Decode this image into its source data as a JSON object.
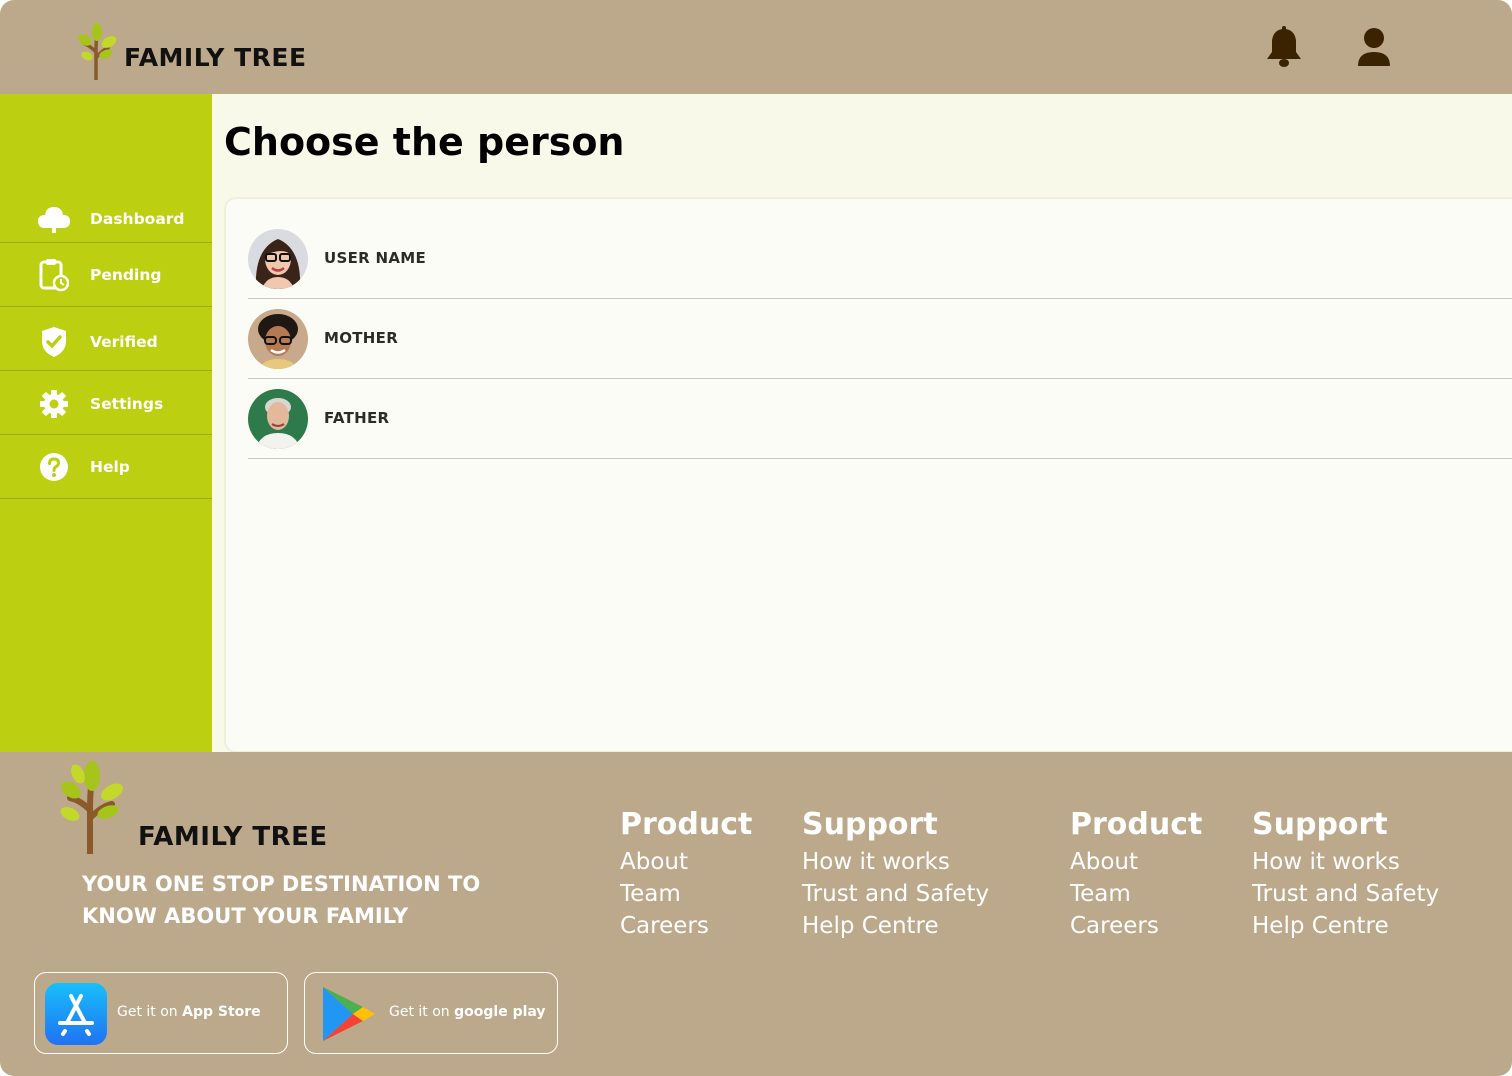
{
  "header": {
    "brand": "FAMILY TREE",
    "icons": [
      "tree-logo-icon",
      "bell-icon",
      "user-icon"
    ]
  },
  "sidebar": {
    "items": [
      {
        "label": "Dashboard",
        "icon": "cloud-icon"
      },
      {
        "label": "Pending",
        "icon": "clipboard-clock-icon"
      },
      {
        "label": "Verified",
        "icon": "shield-check-icon"
      },
      {
        "label": "Settings",
        "icon": "gear-icon"
      },
      {
        "label": "Help",
        "icon": "question-icon"
      }
    ]
  },
  "main": {
    "title": "Choose the person",
    "people": [
      {
        "name": "USER NAME"
      },
      {
        "name": "MOTHER"
      },
      {
        "name": "FATHER"
      }
    ]
  },
  "footer": {
    "brand": "FAMILY TREE",
    "tagline": "YOUR ONE STOP DESTINATION TO KNOW ABOUT YOUR FAMILY",
    "app_store": {
      "prefix": "Get it on",
      "name": "App Store"
    },
    "google_play": {
      "prefix": "Get it on",
      "name": "google play"
    },
    "columns": [
      {
        "title": "Product",
        "links": [
          "About",
          "Team",
          "Careers"
        ]
      },
      {
        "title": "Support",
        "links": [
          "How it works",
          "Trust and Safety",
          "Help Centre"
        ]
      },
      {
        "title": "Product",
        "links": [
          "About",
          "Team",
          "Careers"
        ]
      },
      {
        "title": "Support",
        "links": [
          "How it works",
          "Trust and Safety",
          "Help Centre"
        ]
      }
    ]
  },
  "colors": {
    "header_bg": "#bca98c",
    "sidebar_bg": "#bccf10",
    "main_bg": "#f8f9e9",
    "icon_dark": "#3b2200"
  }
}
